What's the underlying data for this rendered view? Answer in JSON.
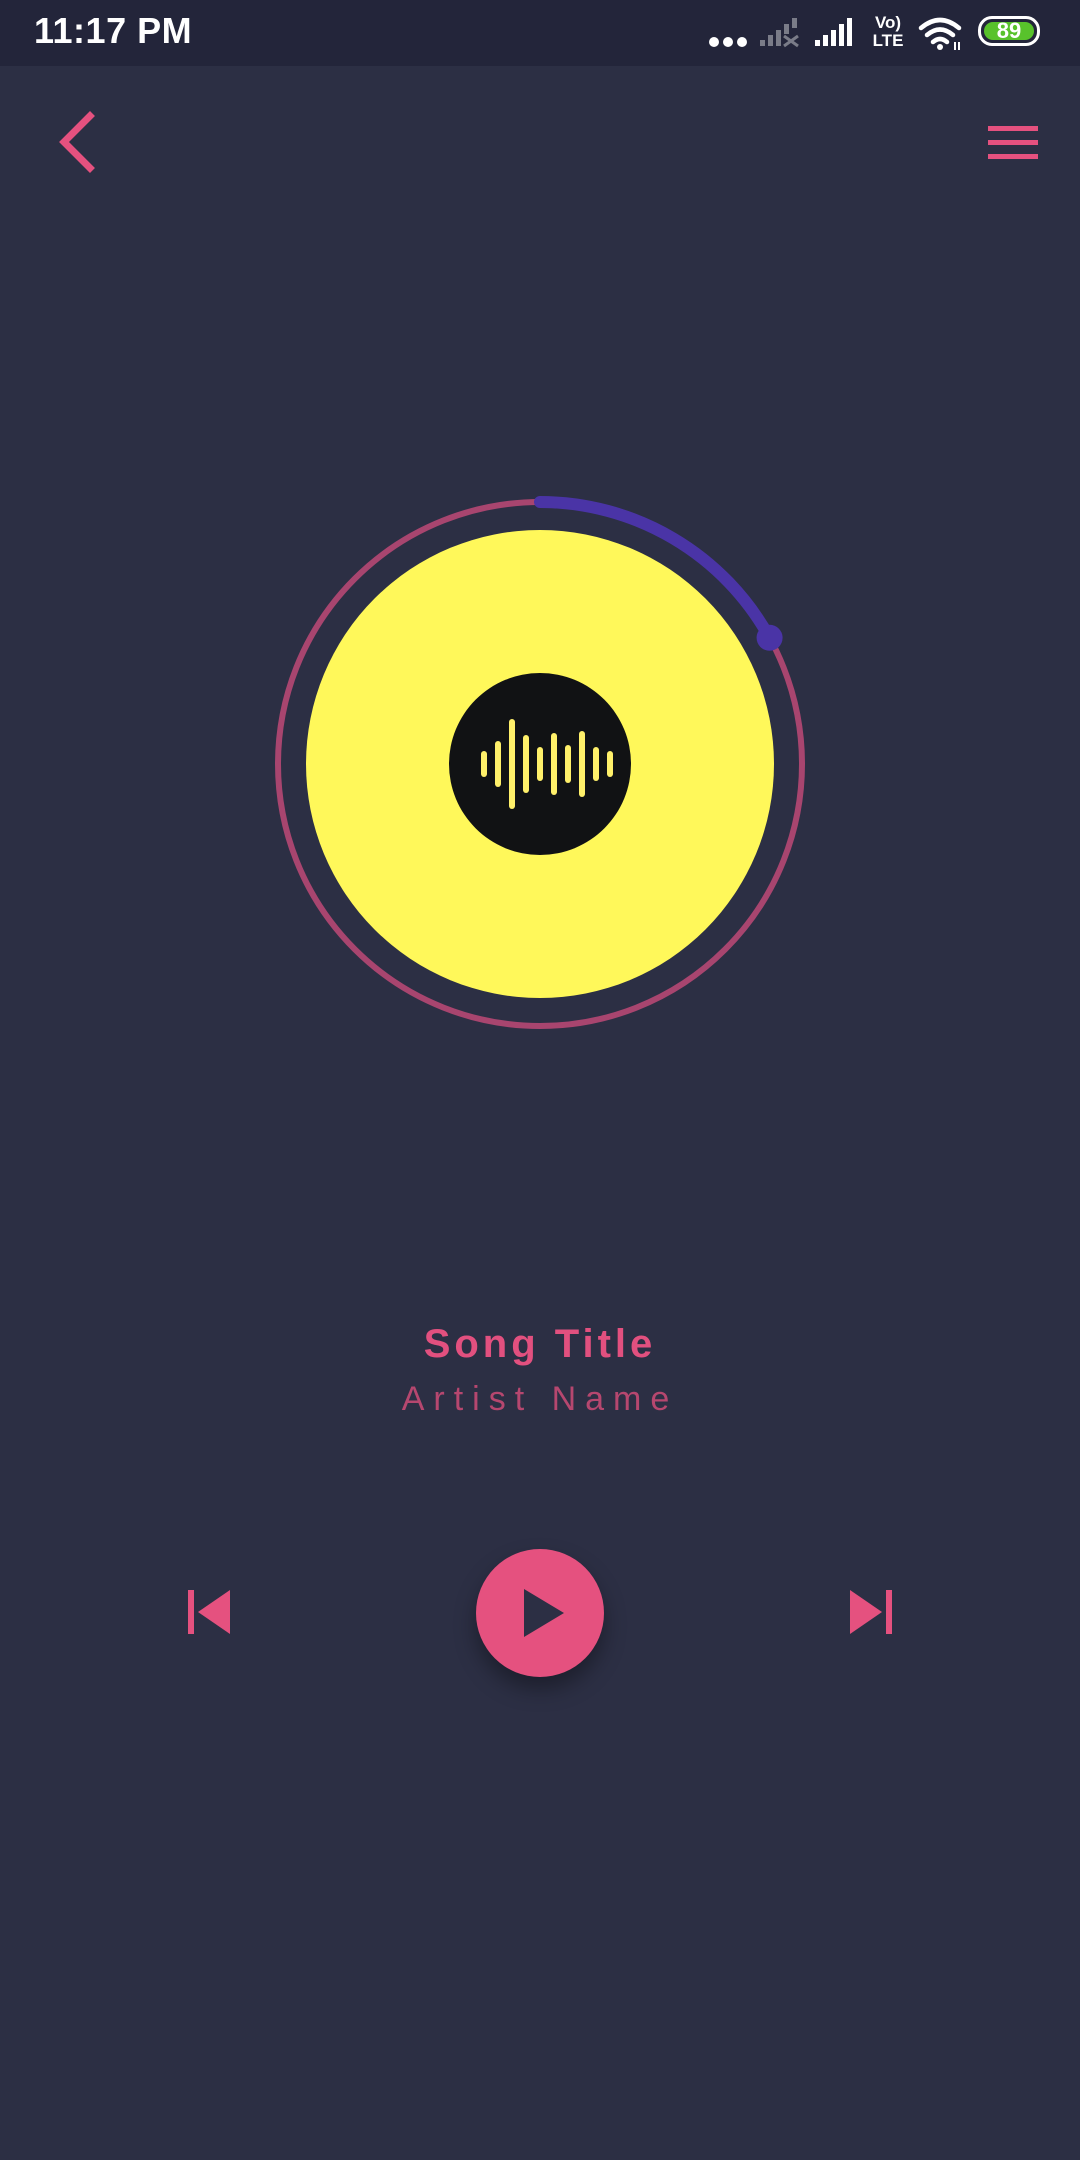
{
  "status_bar": {
    "time": "11:17 PM",
    "network_label_top": "Vo)",
    "network_label_bottom": "LTE",
    "battery": "89",
    "icons": [
      "more-dots-icon",
      "signal-no-service-icon",
      "signal-icon",
      "volte-icon",
      "wifi-icon",
      "battery-icon"
    ]
  },
  "nav": {
    "back_icon": "chevron-left-icon",
    "menu_icon": "hamburger-menu-icon"
  },
  "player": {
    "song_title": "Song Title",
    "artist_name": "Artist Name",
    "progress": 0.17,
    "controls": {
      "previous_icon": "skip-previous-icon",
      "play_icon": "play-icon",
      "next_icon": "skip-next-icon"
    }
  },
  "colors": {
    "background": "#2c2f44",
    "status_bar": "#23253a",
    "accent": "#e5517f",
    "ring": "#a8456f",
    "progress": "#4a34a6",
    "disc": "#fff85a",
    "disc_center": "#111214"
  }
}
